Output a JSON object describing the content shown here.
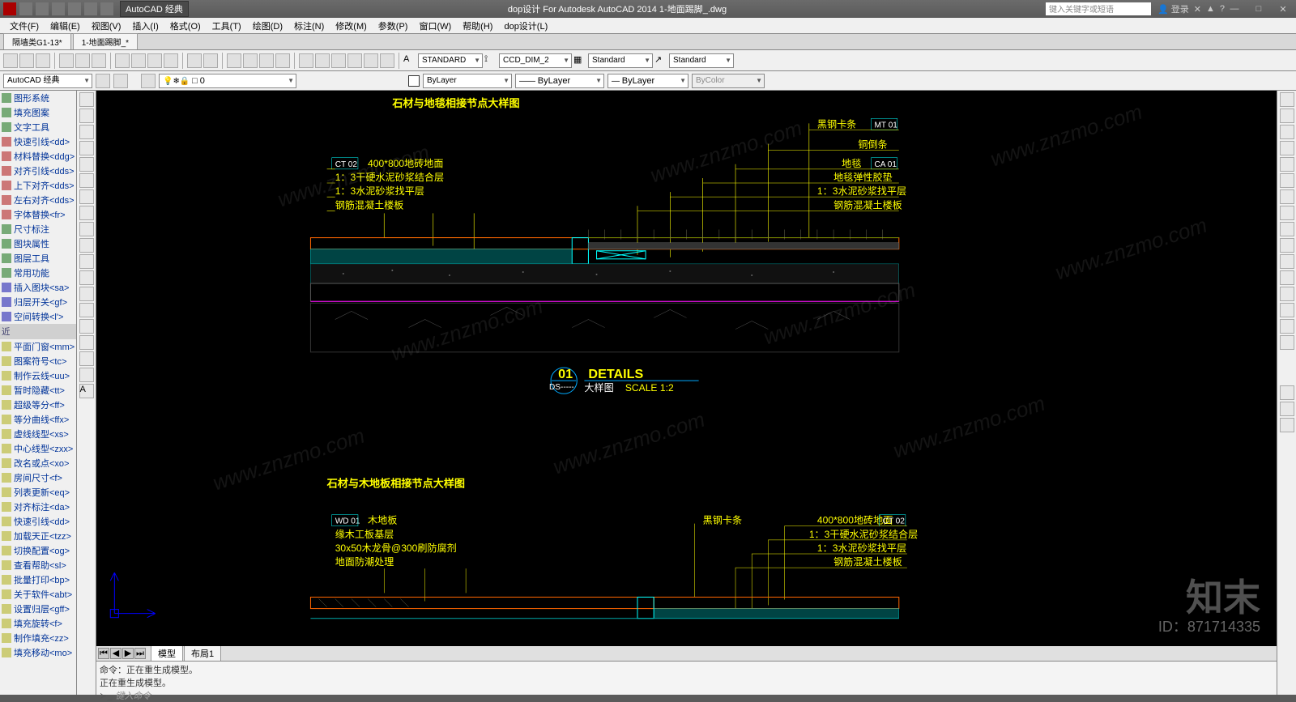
{
  "titlebar": {
    "workspace": "AutoCAD 经典",
    "title": "dop设计 For Autodesk AutoCAD 2014    1-地面踢脚_.dwg",
    "search_placeholder": "键入关键字或短语",
    "login": "登录"
  },
  "menubar": [
    "文件(F)",
    "编辑(E)",
    "视图(V)",
    "插入(I)",
    "格式(O)",
    "工具(T)",
    "绘图(D)",
    "标注(N)",
    "修改(M)",
    "参数(P)",
    "窗口(W)",
    "帮助(H)",
    "dop设计(L)"
  ],
  "doctabs": [
    "隔墙类G1-13*",
    "1-地面踢脚_*"
  ],
  "toolbar1": {
    "style1": "STANDARD",
    "style2": "CCD_DIM_2",
    "style3": "Standard",
    "style4": "Standard"
  },
  "toolbar2": {
    "workspace": "AutoCAD 经典",
    "layer": "□ 0",
    "bylayer1": "ByLayer",
    "bylayer2": "ByLayer",
    "bylayer3": "ByLayer",
    "bycolor": "ByColor"
  },
  "side_panel": {
    "groups": [
      {
        "header": null,
        "items": [
          "图形系统",
          "填充图案",
          "文字工具"
        ]
      },
      {
        "header": null,
        "items": [
          "快速引线<dd>",
          "材料替换<ddg>",
          "对齐引线<dds>",
          "上下对齐<dds>",
          "左右对齐<dds>",
          "字体替换<fr>"
        ]
      },
      {
        "header": null,
        "items": [
          "尺寸标注",
          "图块属性",
          "图层工具",
          "常用功能"
        ]
      },
      {
        "header": null,
        "items": [
          "插入图块<sa>",
          "归层开关<gf>",
          "空间转换<l'>"
        ]
      },
      {
        "header": "近",
        "items": [
          "平面门窗<mm>",
          "图案符号<tc>",
          "制作云线<uu>",
          "暂时隐藏<tt>",
          "超级等分<ff>",
          "等分曲线<ffx>",
          "虚线线型<xs>",
          "中心线型<zxx>",
          "改名或点<xo>",
          "房间尺寸<f>",
          "列表更新<eq>",
          "对齐标注<da>",
          "快速引线<dd>",
          "加载天正<tzz>",
          "切换配置<og>",
          "查看帮助<sl>",
          "批量打印<bp>",
          "关于软件<abt>",
          "设置归层<gff>",
          "填充旋转<f>",
          "制作填充<zz>",
          "填充移动<mo>"
        ]
      }
    ]
  },
  "drawing": {
    "title1": "石材与地毯相接节点大样图",
    "title2": "石材与木地板相接节点大样图",
    "detail_num": "01",
    "detail_en": "DETAILS",
    "detail_cn": "大样图",
    "detail_scale": "SCALE  1:2",
    "detail_ds": "DS-----",
    "left_labels_1": [
      "400*800地砖地面",
      "1：3干硬水泥砂浆结合层",
      "1：3水泥砂浆找平层",
      "钢筋混凝土楼板"
    ],
    "left_tag_1": "CT 02",
    "right_labels_1": [
      "黑钢卡条",
      "铜倒条",
      "地毯",
      "地毯弹性胶垫",
      "1：3水泥砂浆找平层",
      "钢筋混凝土楼板"
    ],
    "right_tag_1a": "MT 01",
    "right_tag_1b": "CA 01",
    "left_labels_2": [
      "木地板",
      "缘木工板基层",
      "30x50木龙骨@300刷防腐剂",
      "地面防潮处理"
    ],
    "left_tag_2": "WD 01",
    "center_label_2": "黑钢卡条",
    "right_labels_2": [
      "400*800地砖地面",
      "1：3干硬水泥砂浆结合层",
      "1：3水泥砂浆找平层",
      "钢筋混凝土楼板"
    ],
    "right_tag_2": "CT 02"
  },
  "bottom_tabs": [
    "模型",
    "布局1"
  ],
  "cmdline": {
    "hist1": "命令：正在重生成模型。",
    "hist2": "正在重生成模型。",
    "prompt": "键入命令"
  },
  "watermark": {
    "text": "www.znzmo.com",
    "brand": "知末",
    "id": "ID：871714335"
  }
}
